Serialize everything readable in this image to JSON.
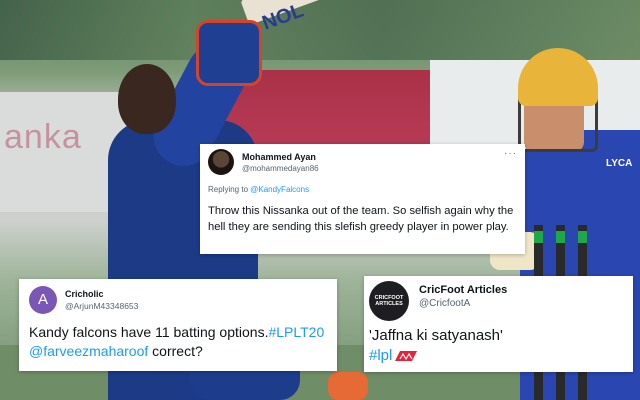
{
  "background_photo": {
    "bat_text": "NOL",
    "keeper_logo": "LYCA"
  },
  "tweets": [
    {
      "name": "Mohammed Ayan",
      "handle": "@mohammedayan86",
      "more_icon": "more-horizontal-icon",
      "reply_prefix": "Replying to ",
      "reply_to": "@KandyFalcons",
      "text": "Throw this Nissanka out of the team. So selfish again why the hell they are sending this slefish greedy player in power play."
    },
    {
      "name": "Cricholic",
      "handle": "@ArjunM43348653",
      "avatar_letter": "A",
      "text_before": "Kandy falcons have 11 batting options.",
      "hashtag": "#LPLT20",
      "mention": "@farveezmaharoof",
      "text_after": " correct?"
    },
    {
      "name": "CricFoot Articles",
      "handle": "@CricfootA",
      "avatar_text": "CRICFOOT ARTICLES",
      "text": "'Jaffna ki satyanash'",
      "hashtag": "#lpl",
      "hashtag_emoji": "lpl-logo-icon"
    }
  ],
  "colors": {
    "link": "#1d9bf0",
    "avatar_purple": "#7b57b5",
    "text": "#0f1419",
    "secondary": "#536471"
  }
}
